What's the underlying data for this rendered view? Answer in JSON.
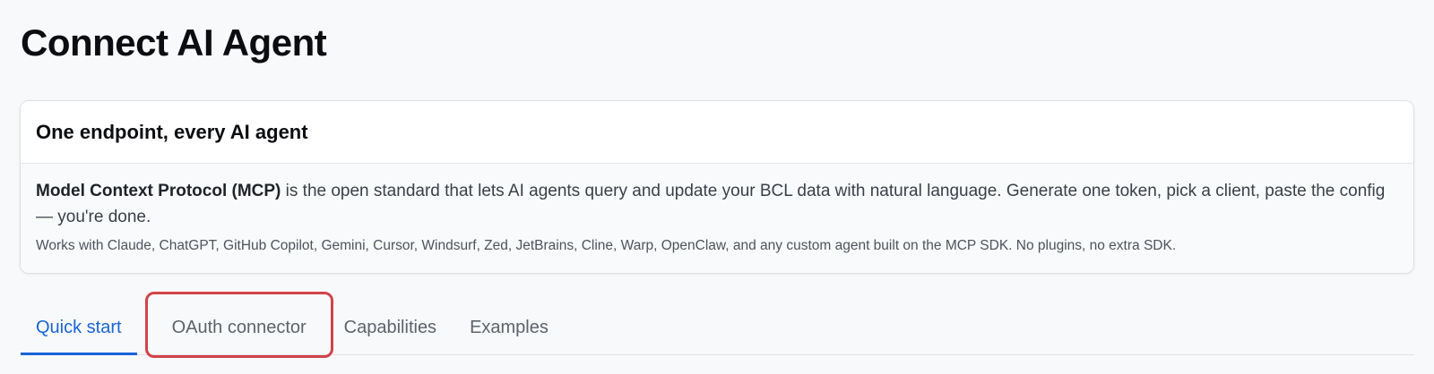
{
  "page": {
    "title": "Connect AI Agent"
  },
  "card": {
    "title": "One endpoint, every AI agent",
    "intro_bold": "Model Context Protocol (MCP)",
    "intro_rest": " is the open standard that lets AI agents query and update your BCL data with natural language. Generate one token, pick a client, paste the config — you're done.",
    "works_with": "Works with Claude, ChatGPT, GitHub Copilot, Gemini, Cursor, Windsurf, Zed, JetBrains, Cline, Warp, OpenClaw, and any custom agent built on the MCP SDK. No plugins, no extra SDK."
  },
  "tabs": [
    {
      "label": "Quick start",
      "active": true
    },
    {
      "label": "OAuth connector",
      "active": false,
      "highlighted": true
    },
    {
      "label": "Capabilities",
      "active": false
    },
    {
      "label": "Examples",
      "active": false
    }
  ],
  "colors": {
    "accent": "#1a64d6",
    "highlight": "#d2434a"
  }
}
